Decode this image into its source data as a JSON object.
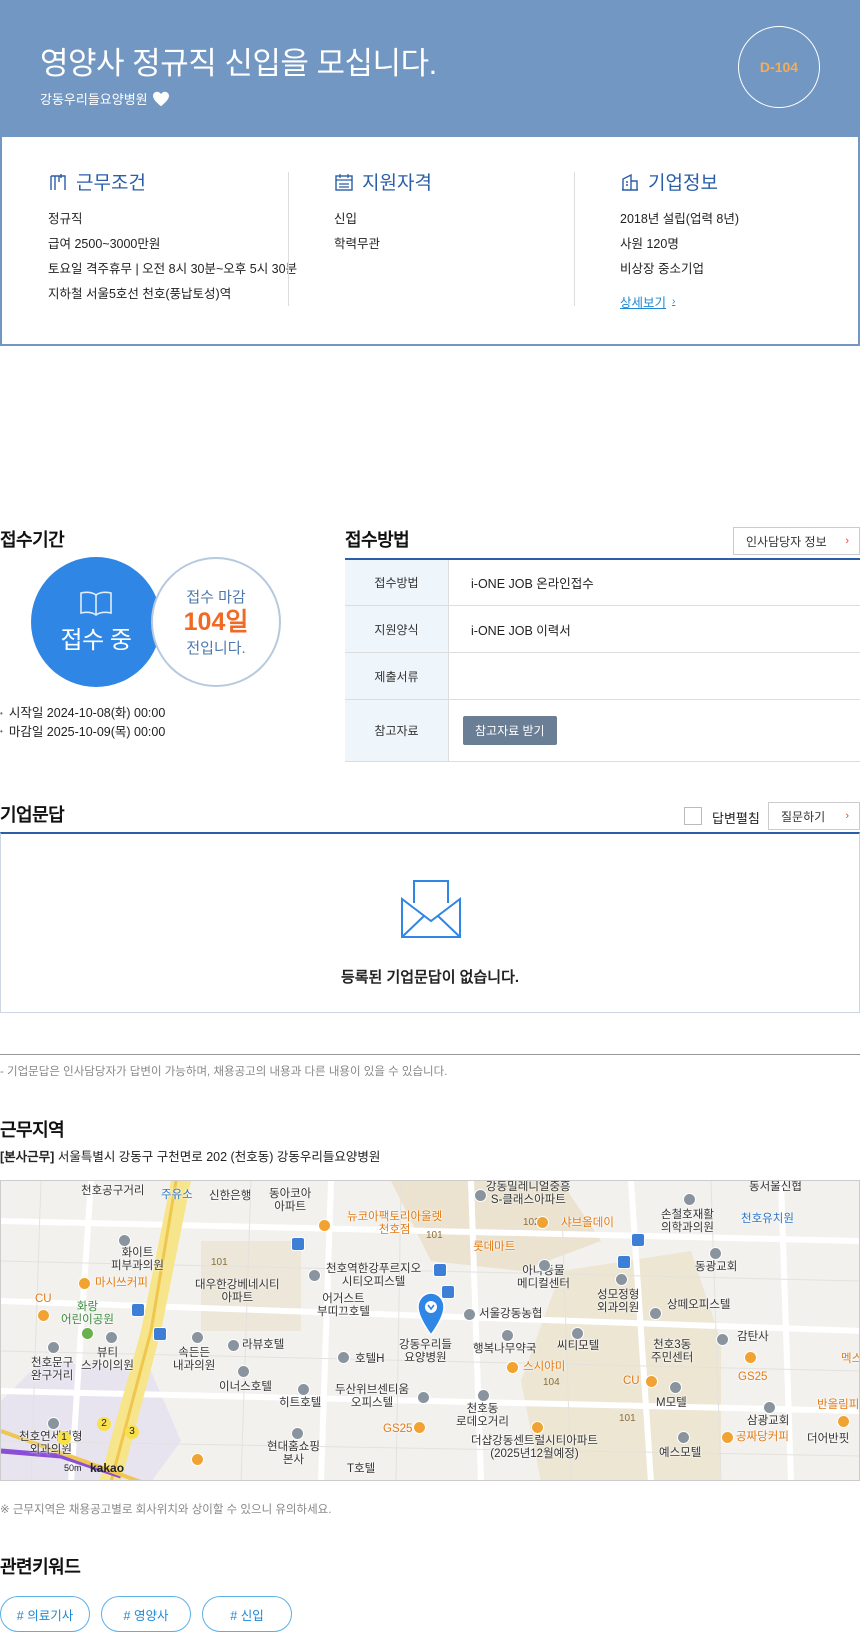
{
  "header": {
    "title": "영양사 정규직 신입을 모십니다.",
    "company": "강동우리들요양병원",
    "dday": "D-104",
    "background_color": "#7197c2",
    "dday_color": "#f4ad58"
  },
  "summary": {
    "work_conditions": {
      "title": "근무조건",
      "items": [
        "정규직",
        "급여 2500~3000만원",
        "토요일 격주휴무 | 오전 8시 30분~오후 5시 30분",
        "지하철 서울5호선 천호(풍납토성)역"
      ]
    },
    "qualifications": {
      "title": "지원자격",
      "items": [
        "신입",
        "학력무관"
      ]
    },
    "company_info": {
      "title": "기업정보",
      "items": [
        "2018년 설립(업력 8년)",
        "사원 120명",
        "비상장 중소기업"
      ],
      "more_label": "상세보기",
      "more_chevron": "›"
    }
  },
  "reception_period": {
    "title": "접수기간",
    "status": "접수 중",
    "deadline_line1": "접수 마감",
    "deadline_days": "104일",
    "deadline_line3": "전입니다.",
    "start": "시작일 2024-10-08(화) 00:00",
    "end": "마감일 2025-10-09(목) 00:00",
    "accent_color": "#2f86e4",
    "days_color": "#f06a24"
  },
  "reception_method": {
    "title": "접수방법",
    "hr_button": "인사담당자 정보",
    "rows": [
      {
        "label": "접수방법",
        "value": "i-ONE JOB 온라인접수"
      },
      {
        "label": "지원양식",
        "value": "i-ONE JOB 이력서"
      },
      {
        "label": "제출서류",
        "value": ""
      },
      {
        "label": "참고자료",
        "value": ""
      }
    ],
    "ref_button": "참고자료 받기"
  },
  "qna": {
    "title": "기업문답",
    "expand_label": "답변펼침",
    "ask_button": "질문하기",
    "empty_message": "등록된 기업문답이 없습니다.",
    "note": "- 기업문답은 인사담당자가 답변이 가능하며, 채용공고의 내용과 다른 내용이 있을 수 있습니다."
  },
  "location": {
    "title": "근무지역",
    "tag": "[본사근무]",
    "address": "서울특별시 강동구 구천면로 202 (천호동) 강동우리들요양병원",
    "note": "※ 근무지역은 채용공고별로 회사위치와 상이할 수 있으니 유의하세요.",
    "map": {
      "provider": "kakao",
      "scale": "50m",
      "marker_label": "강동우리들\n요양병원",
      "labels": [
        "천호공구거리",
        "주유소",
        "신한은행",
        "동아코아\n아파트",
        "뉴코아팩토리아울렛\n천호점",
        "강동밀레니얼중흥\nS-클래스아파트",
        "샤브올데이",
        "손철호재활\n의학과의원",
        "천호유치원",
        "동서울신협",
        "화이트\n피부과의원",
        "마시쓰커피",
        "대우한강베네시티\n아파트",
        "천호역한강푸르지오\n시티오피스텔",
        "어거스트\n부띠끄호텔",
        "롯데마트",
        "아나동물\n메디컬센터",
        "성모정형\n외과의원",
        "동광교회",
        "상떼오피스텔",
        "화랑\n어린이공원",
        "CU",
        "서울강동농협",
        "행복나무약국",
        "씨티모텔",
        "천호3동\n주민센터",
        "감탄사",
        "천호문구\n완구거리",
        "뷰티\n스카이의원",
        "속든든\n내과의원",
        "라뷰호텔",
        "호텔H",
        "스시야미",
        "GS25",
        "CU",
        "M모텔",
        "이너스호텔",
        "히트호텔",
        "두산위브센티움\n오피스텔",
        "천호동\n로데오거리",
        "삼광교회",
        "공짜당커피",
        "반올림피",
        "더어반핏",
        "GS25",
        "현대홈쇼핑\n본사",
        "더샵강동센트럴시티아파트\n(2025년12월예정)",
        "예스모텔",
        "천호연세정형\n외과의원",
        "멕스",
        "T호텔"
      ],
      "numbers": [
        "101",
        "102",
        "101",
        "104",
        "101",
        "102",
        "1",
        "2",
        "3"
      ]
    }
  },
  "keywords": {
    "title": "관련키워드",
    "items": [
      "# 의료기사",
      "# 영양사",
      "# 신입"
    ]
  }
}
